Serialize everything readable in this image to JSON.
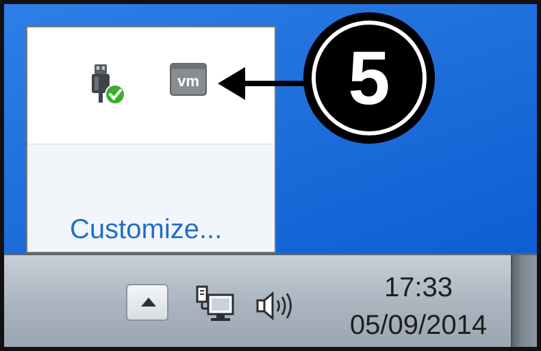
{
  "overflow_panel": {
    "icons": [
      "usb-safely-remove-icon",
      "vmware-tray-icon"
    ],
    "customize_label": "Customize..."
  },
  "callout": {
    "number": "5"
  },
  "taskbar": {
    "overflow_button_icon": "chevron-up-icon",
    "tray_icons": [
      "network-icon",
      "volume-icon"
    ],
    "clock_time": "17:33",
    "clock_date": "05/09/2014"
  },
  "colors": {
    "desktop_blue": "#1f6fdc",
    "link_blue": "#1f6fc9",
    "taskbar_gray": "#aab4bf",
    "check_green": "#3cae2c",
    "callout_black": "#000000"
  }
}
